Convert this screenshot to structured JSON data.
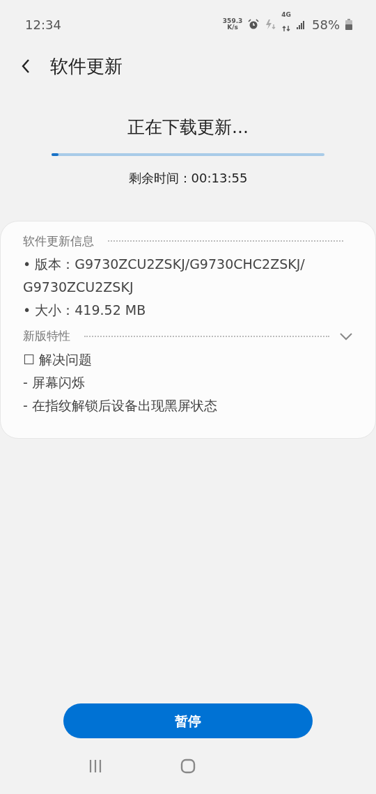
{
  "status_bar": {
    "time": "12:34",
    "speed": "359.3",
    "speed_unit": "K/s",
    "network": "4G",
    "battery": "58%"
  },
  "header": {
    "title": "软件更新"
  },
  "download": {
    "title": "正在下载更新...",
    "level": 0.025,
    "remaining": "剩余时间：00:13:55"
  },
  "info": {
    "heading": "软件更新信息",
    "lines": [
      "• 版本：G9730ZCU2ZSKJ/G9730CHC2ZSKJ/\nG9730ZCU2ZSKJ",
      "• 大小：419.52 MB"
    ]
  },
  "features": {
    "heading": "新版特性",
    "expanded": true,
    "lines": [
      "☐ 解决问题",
      " - 屏幕闪烁",
      " - 在指纹解锁后设备出现黑屏状态"
    ]
  },
  "buttons": [
    "暂停"
  ]
}
